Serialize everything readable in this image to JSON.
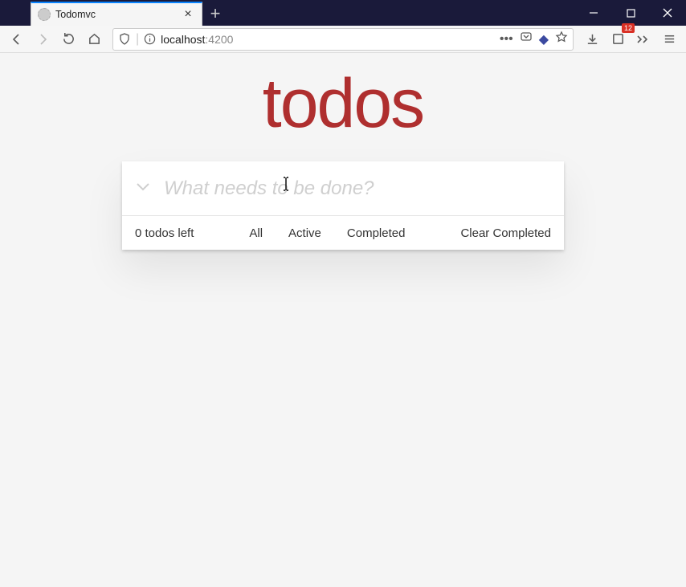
{
  "browser": {
    "tab_title": "Todomvc",
    "url_host": "localhost",
    "url_port": ":4200",
    "ext_badge": "12"
  },
  "app": {
    "title": "todos",
    "input_placeholder": "What needs to be done?",
    "count_text": "0 todos left",
    "filters": {
      "all": "All",
      "active": "Active",
      "completed": "Completed"
    },
    "clear_label": "Clear Completed"
  }
}
